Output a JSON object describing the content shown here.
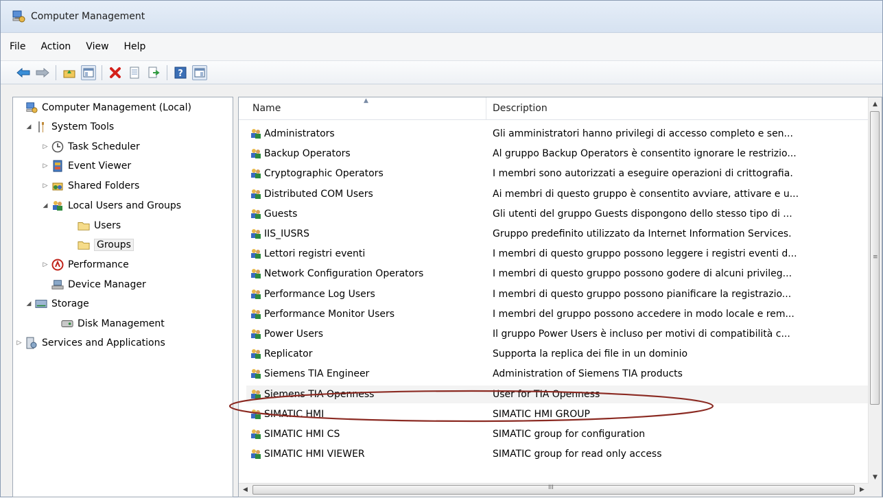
{
  "window": {
    "title": "Computer Management"
  },
  "menu": [
    "File",
    "Action",
    "View",
    "Help"
  ],
  "tree": {
    "items": [
      {
        "label": "Computer Management (Local)",
        "icon": "computer-management-icon",
        "expander": ""
      },
      {
        "label": "System Tools",
        "icon": "system-tools-icon",
        "expander": "◢"
      },
      {
        "label": "Task Scheduler",
        "icon": "clock-icon",
        "expander": "▷"
      },
      {
        "label": "Event Viewer",
        "icon": "event-viewer-icon",
        "expander": "▷"
      },
      {
        "label": "Shared Folders",
        "icon": "shared-folders-icon",
        "expander": "▷"
      },
      {
        "label": "Local Users and Groups",
        "icon": "users-groups-icon",
        "expander": "◢"
      },
      {
        "label": "Users",
        "icon": "folder-icon",
        "expander": ""
      },
      {
        "label": "Groups",
        "icon": "folder-icon",
        "expander": ""
      },
      {
        "label": "Performance",
        "icon": "performance-icon",
        "expander": "▷"
      },
      {
        "label": "Device Manager",
        "icon": "device-manager-icon",
        "expander": ""
      },
      {
        "label": "Storage",
        "icon": "storage-icon",
        "expander": "◢"
      },
      {
        "label": "Disk Management",
        "icon": "disk-icon",
        "expander": ""
      },
      {
        "label": "Services and Applications",
        "icon": "services-icon",
        "expander": "▷"
      }
    ]
  },
  "list": {
    "columns": {
      "name": "Name",
      "description": "Description"
    },
    "rows": [
      {
        "name": "Administrators",
        "description": "Gli amministratori hanno privilegi di accesso completo e sen..."
      },
      {
        "name": "Backup Operators",
        "description": "Al gruppo Backup Operators è consentito ignorare le restrizio..."
      },
      {
        "name": "Cryptographic Operators",
        "description": "I membri sono autorizzati a eseguire operazioni di crittografia."
      },
      {
        "name": "Distributed COM Users",
        "description": "Ai membri di questo gruppo è consentito avviare, attivare e u..."
      },
      {
        "name": "Guests",
        "description": "Gli utenti del gruppo Guests dispongono dello stesso tipo di ..."
      },
      {
        "name": "IIS_IUSRS",
        "description": "Gruppo predefinito utilizzato da Internet Information Services."
      },
      {
        "name": "Lettori registri eventi",
        "description": "I membri di questo gruppo possono leggere i registri eventi d..."
      },
      {
        "name": "Network Configuration Operators",
        "description": "I membri di questo gruppo possono godere di alcuni privileg..."
      },
      {
        "name": "Performance Log Users",
        "description": "I membri di questo gruppo possono pianificare la registrazio..."
      },
      {
        "name": "Performance Monitor Users",
        "description": "I membri del gruppo possono accedere in modo locale e rem..."
      },
      {
        "name": "Power Users",
        "description": "Il gruppo Power Users è incluso per motivi di compatibilità c..."
      },
      {
        "name": "Replicator",
        "description": "Supporta la replica dei file in un dominio"
      },
      {
        "name": "Siemens TIA Engineer",
        "description": "Administration of Siemens TIA products"
      },
      {
        "name": "Siemens TIA Openness",
        "description": "User for TIA Openness"
      },
      {
        "name": "SIMATIC HMI",
        "description": "SIMATIC HMI GROUP"
      },
      {
        "name": "SIMATIC HMI CS",
        "description": "SIMATIC group for configuration"
      },
      {
        "name": "SIMATIC HMI VIEWER",
        "description": "SIMATIC group for read only access"
      }
    ]
  },
  "scroll": {
    "hgrip": "III",
    "vgrip": "≡"
  },
  "colors": {
    "annotation": "#8b2a22",
    "accent": "#3a78c8"
  }
}
